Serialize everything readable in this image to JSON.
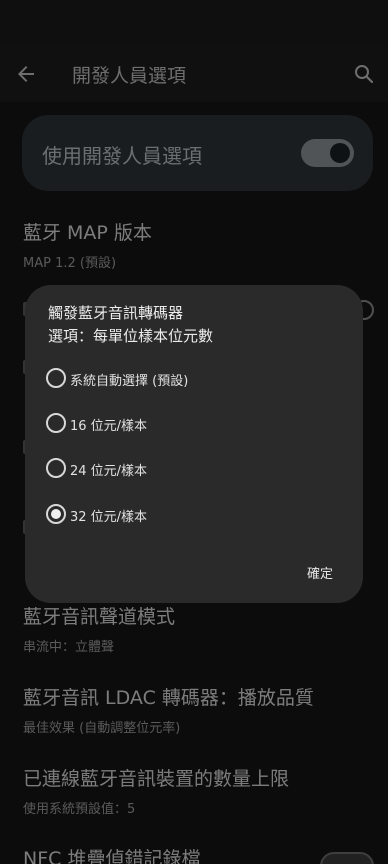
{
  "appbar": {
    "title": "開發人員選項",
    "back_icon": "arrow-back-icon",
    "search_icon": "search-icon"
  },
  "master_switch": {
    "label": "使用開發人員選項",
    "state": "on"
  },
  "settings": [
    {
      "title": "藍牙 MAP 版本",
      "summary": "MAP 1.2 (預設)"
    },
    {
      "title": "藍牙音訊聲道模式",
      "summary": "串流中：立體聲"
    },
    {
      "title": "藍牙音訊 LDAC 轉碼器：播放品質",
      "summary": "最佳效果 (自動調整位元率)"
    },
    {
      "title": "已連線藍牙音訊裝置的數量上限",
      "summary": "使用系統預設值：5"
    },
    {
      "title": "NFC 堆疊偵錯記錄檔",
      "summary": ""
    }
  ],
  "dialog": {
    "title": "觸發藍牙音訊轉碼器\n選項：每單位樣本位元數",
    "options": [
      {
        "label": "系統自動選擇 (預設)",
        "selected": false
      },
      {
        "label": "16 位元/樣本",
        "selected": false
      },
      {
        "label": "24 位元/樣本",
        "selected": false
      },
      {
        "label": "32 位元/樣本",
        "selected": true
      }
    ],
    "confirm_label": "確定"
  }
}
